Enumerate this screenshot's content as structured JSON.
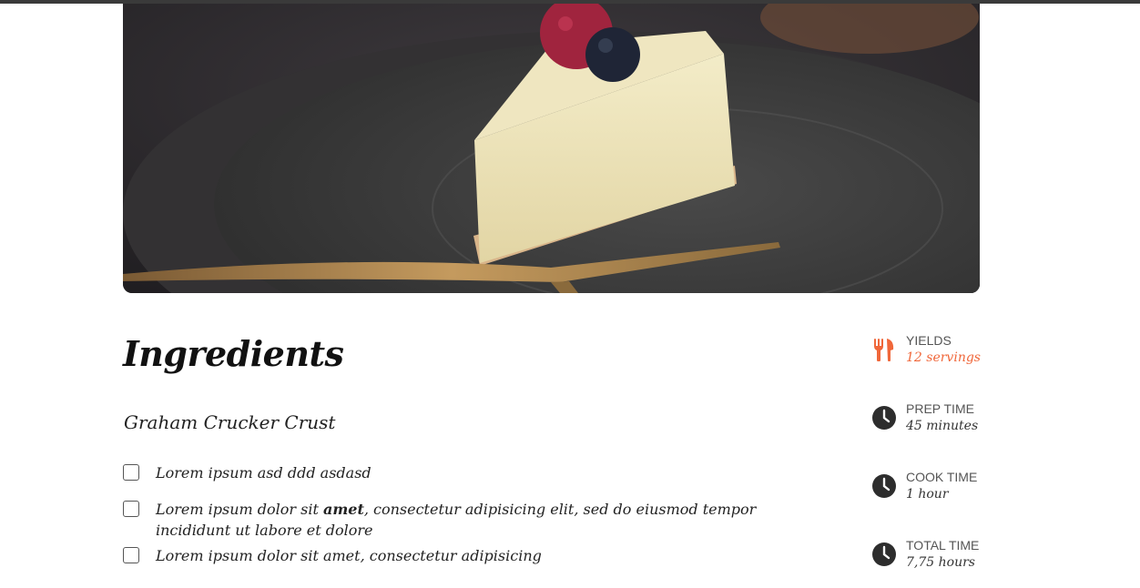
{
  "hero": {
    "image": "cheesecake-slice-with-berries-on-dark-plate"
  },
  "ingredients": {
    "title": "Ingredients",
    "section_title": "Graham Crucker Crust",
    "items": [
      {
        "pre": "Lorem ipsum asd ddd asdasd",
        "bold": "",
        "post": ""
      },
      {
        "pre": "Lorem ipsum dolor sit ",
        "bold": "amet",
        "post": ", consectetur adipisicing elit, sed do eiusmod tempor incididunt ut labore et dolore"
      },
      {
        "pre": "Lorem ipsum dolor sit amet, consectetur adipisicing",
        "bold": "",
        "post": ""
      }
    ]
  },
  "meta": {
    "yields": {
      "label": "YIELDS",
      "value": "12 servings",
      "icon": "fork-knife-icon"
    },
    "prep": {
      "label": "PREP TIME",
      "value": "45 minutes",
      "icon": "clock-icon"
    },
    "cook": {
      "label": "COOK TIME",
      "value": "1 hour",
      "icon": "clock-icon"
    },
    "total": {
      "label": "TOTAL TIME",
      "value": "7,75 hours",
      "icon": "clock-icon"
    }
  },
  "colors": {
    "accent": "#f0673a",
    "icon_dark": "#2d2d2d",
    "top_bar": "#3a3a3a"
  }
}
